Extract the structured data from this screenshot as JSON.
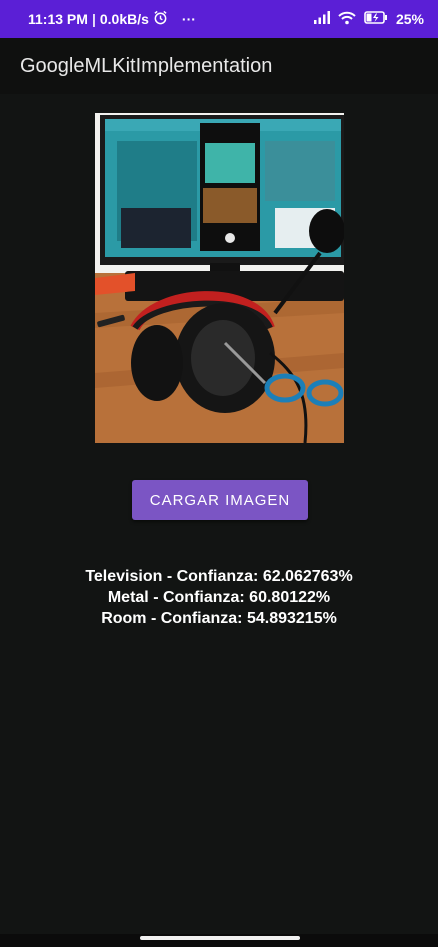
{
  "status_bar": {
    "time": "11:13 PM",
    "separator": "|",
    "net_speed": "0.0kB/s",
    "alarm_icon": "alarm-icon",
    "more": "···",
    "signal_icon": "signal-icon",
    "wifi_icon": "wifi-icon",
    "battery_icon": "battery-charging-icon",
    "battery": "25%",
    "color": "#5b1fd6"
  },
  "app_bar": {
    "title": "GoogleMLKitImplementation"
  },
  "image": {
    "description_icon": "photo-headphones-desk"
  },
  "button": {
    "label": "CARGAR IMAGEN",
    "color": "#7b55c4"
  },
  "results": [
    "Television - Confianza: 62.062763%",
    "Metal - Confianza: 60.80122%",
    "Room - Confianza: 54.893215%"
  ]
}
